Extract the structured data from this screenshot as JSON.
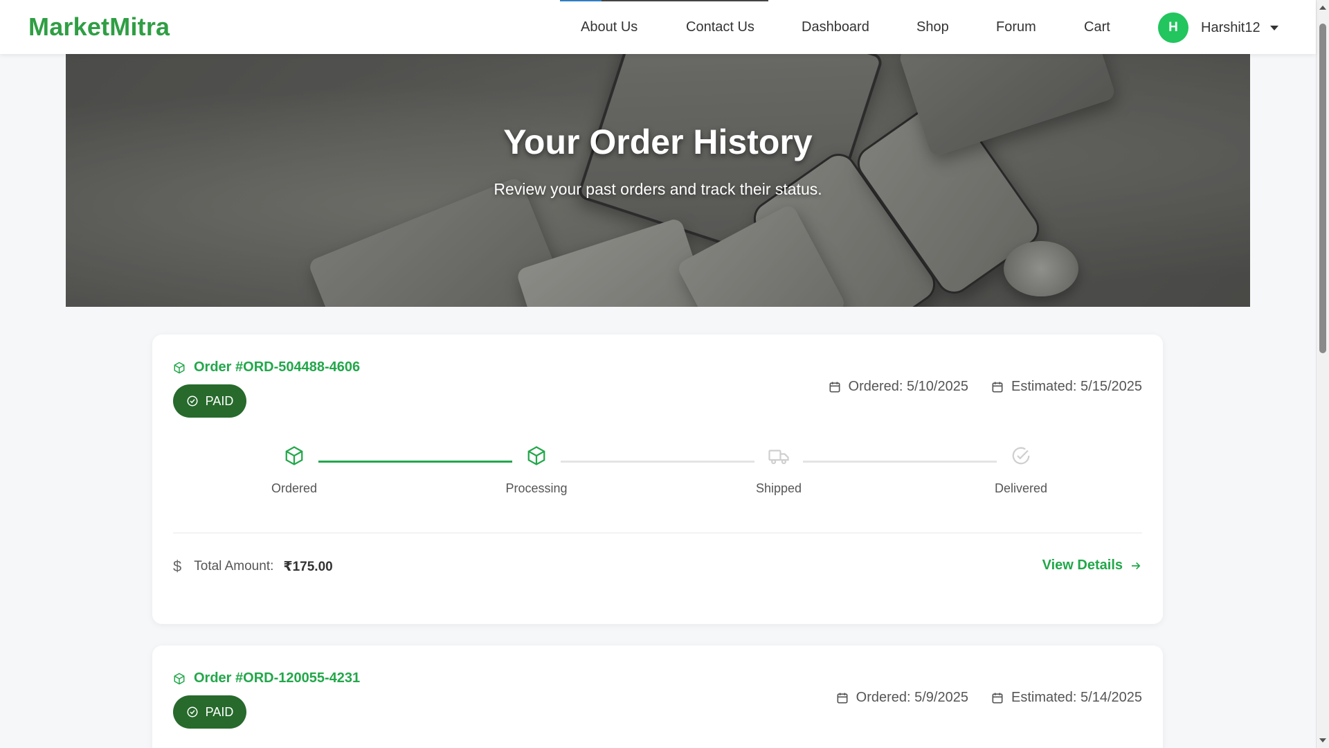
{
  "brand": "MarketMitra",
  "nav": {
    "links": [
      "About Us",
      "Contact Us",
      "Dashboard",
      "Shop",
      "Forum",
      "Cart"
    ],
    "user": {
      "initial": "H",
      "name": "Harshit12"
    }
  },
  "hero": {
    "title": "Your Order History",
    "subtitle": "Review your past orders and track their status."
  },
  "labels": {
    "ordered_prefix": "Ordered:",
    "estimated_prefix": "Estimated:",
    "total_amount": "Total Amount:",
    "view_details": "View Details"
  },
  "orders": [
    {
      "id": "Order #ORD-504488-4606",
      "status": "PAID",
      "ordered": "Ordered: 5/10/2025",
      "estimated": "Estimated: 5/15/2025",
      "steps": [
        "Ordered",
        "Processing",
        "Shipped",
        "Delivered"
      ],
      "completed_steps": 2,
      "total_label": "Total Amount:",
      "total": "₹175.00",
      "action": "View Details"
    },
    {
      "id": "Order #ORD-120055-4231",
      "status": "PAID",
      "ordered": "Ordered: 5/9/2025",
      "estimated": "Estimated: 5/14/2025"
    }
  ],
  "colors": {
    "brand_green": "#2f9e44",
    "accent_green": "#22a74a",
    "badge_green": "#276a2c",
    "avatar_green": "#22c55e",
    "inactive_gray": "#cfcfcf"
  },
  "icons": {
    "order": "package-icon",
    "badge": "check-circle-icon",
    "date": "calendar-icon",
    "step_ordered": "package-icon",
    "step_processing": "package-icon",
    "step_shipped": "truck-icon",
    "step_delivered": "check-circle-icon",
    "total": "dollar-icon",
    "action": "arrow-right-icon"
  }
}
